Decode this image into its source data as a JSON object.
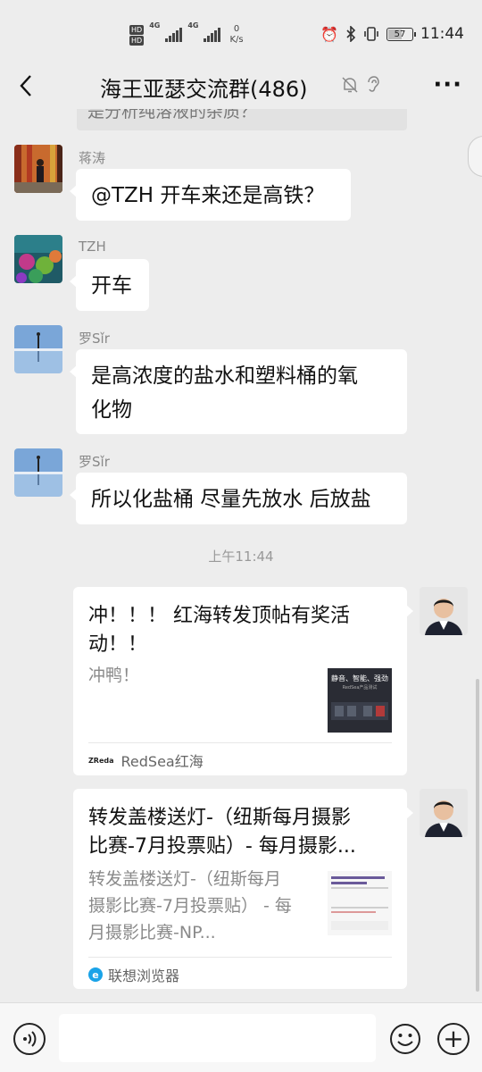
{
  "status_bar": {
    "network_badges": [
      "HD",
      "HD"
    ],
    "network_types": [
      "4G",
      "4G"
    ],
    "speed_value": "0",
    "speed_unit": "K/s",
    "icons": [
      "alarm-icon",
      "bluetooth-icon",
      "vibrate-icon"
    ],
    "battery": "57",
    "time": "11:44"
  },
  "header": {
    "title": "海王亚瑟交流群(486)",
    "back_icon": "chevron-left-icon",
    "mute_icon": "bell-off-icon",
    "earpiece_icon": "ear-icon",
    "more_label": "···"
  },
  "messages": [
    {
      "type": "partial",
      "text": "是分析纯溶液的杂质？"
    },
    {
      "type": "text",
      "sender": "蒋涛",
      "text": "@TZH  开车来还是高铁？"
    },
    {
      "type": "text",
      "sender": "TZH",
      "text": "开车"
    },
    {
      "type": "text",
      "sender": "罗Sǐr",
      "text_lines": [
        "是高浓度的盐水和塑料桶的氧",
        "化物"
      ]
    },
    {
      "type": "text",
      "sender": "罗Sǐr",
      "text": "所以化盐桶 尽量先放水 后放盐"
    }
  ],
  "time_divider": "上午11:44",
  "cards": [
    {
      "title_lines": [
        "冲！！！ 红海转发顶帖有奖活",
        "动！！"
      ],
      "desc_lines": [
        "冲鸭！"
      ],
      "thumb_lines": [
        "静音、智能、强劲",
        "RedSea产品测试"
      ],
      "source_logo": "ZReda",
      "source": "RedSea红海"
    },
    {
      "title_lines": [
        "转发盖楼送灯-（纽斯每月摄影",
        "比赛-7月投票贴）- 每月摄影..."
      ],
      "desc_lines": [
        "转发盖楼送灯-（纽斯每月",
        "摄影比赛-7月投票贴） - 每",
        "月摄影比赛-NP..."
      ],
      "source_logo": "e",
      "source": "联想浏览器"
    }
  ],
  "input": {
    "placeholder": "",
    "voice_icon": "voice-icon",
    "emoji_icon": "emoji-icon",
    "plus_label": "+"
  },
  "colors": {
    "background": "#ededed",
    "bubble": "#ffffff",
    "accent_blue": "#1aa3e8"
  }
}
